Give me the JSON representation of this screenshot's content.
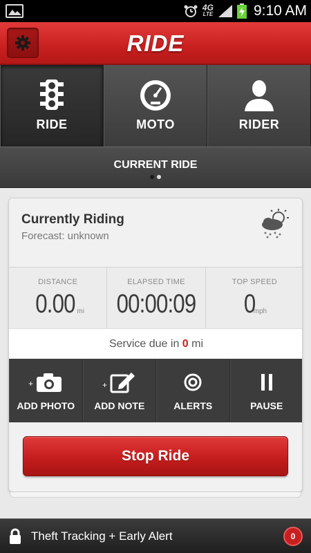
{
  "status_bar": {
    "time": "9:10 AM",
    "network": "4G",
    "network_sub": "LTE"
  },
  "header": {
    "title": "RIDE",
    "settings_icon": "gear-icon"
  },
  "tabs": [
    {
      "label": "RIDE",
      "icon": "traffic-light-icon",
      "active": true
    },
    {
      "label": "MOTO",
      "icon": "speedometer-icon",
      "active": false
    },
    {
      "label": "RIDER",
      "icon": "person-icon",
      "active": false
    }
  ],
  "section": {
    "title": "CURRENT RIDE",
    "page_index": 1,
    "page_count": 2
  },
  "ride": {
    "title": "Currently Riding",
    "forecast": "Forecast: unknown",
    "weather_icon": "cloudy-sun-icon",
    "stats": [
      {
        "label": "DISTANCE",
        "value": "0.00",
        "unit": "mi"
      },
      {
        "label": "ELAPSED TIME",
        "value": "00:00:09",
        "unit": ""
      },
      {
        "label": "TOP SPEED",
        "value": "0",
        "unit": "mph"
      }
    ],
    "service_prefix": "Service due in",
    "service_value": "0",
    "service_suffix": "mi"
  },
  "actions": [
    {
      "label": "ADD PHOTO",
      "icon": "camera-icon"
    },
    {
      "label": "ADD NOTE",
      "icon": "edit-note-icon"
    },
    {
      "label": "ALERTS",
      "icon": "target-icon"
    },
    {
      "label": "PAUSE",
      "icon": "pause-icon"
    }
  ],
  "stop_button": "Stop Ride",
  "bottom_bar": {
    "label": "Theft Tracking + Early Alert",
    "badge": "0",
    "icon": "lock-icon"
  },
  "colors": {
    "accent": "#c81f1f",
    "dark": "#3c3c3c"
  }
}
